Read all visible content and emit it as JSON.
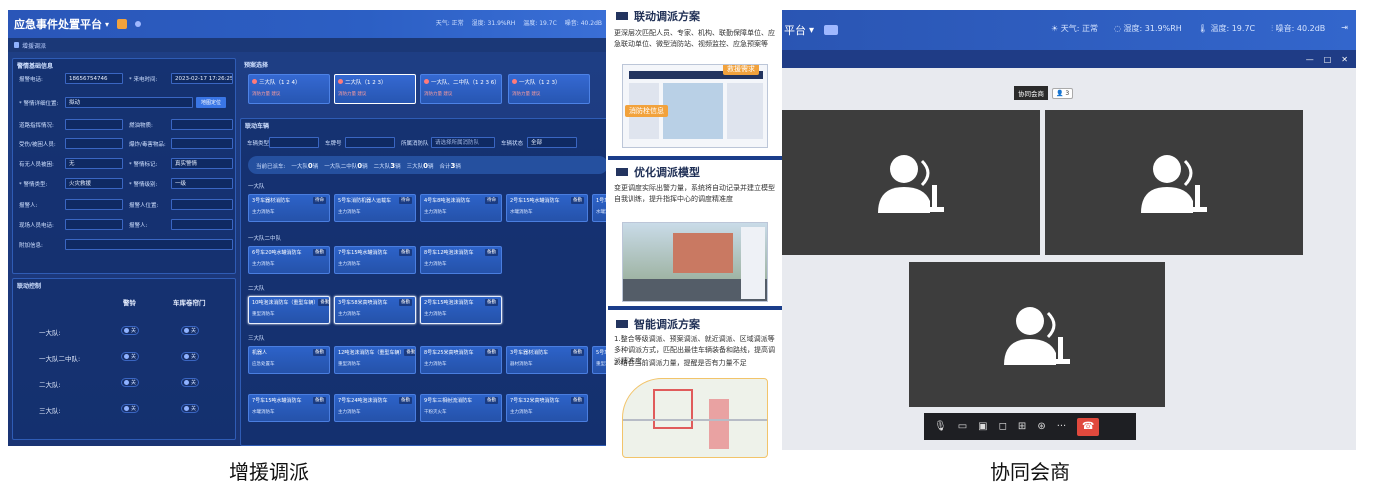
{
  "left": {
    "title": "应急事件处置平台",
    "status": [
      "天气: 正常",
      "湿度: 31.9%RH",
      "温度: 19.7C",
      "噪音: 40.2dB"
    ],
    "subbar": "增援调派",
    "info": {
      "title": "警情基础信息",
      "phone_label": "报警电话:",
      "phone_value": "18656754746",
      "time_label": "* 来电时间:",
      "time_value": "2023-02-17 17:26:25",
      "addr_label": "* 警情详细位置:",
      "addr_value": "拟动",
      "map_btn": "地图定位",
      "r3a": "道路指挥情况:",
      "r3b": "燃油物质:",
      "r4a": "受伤/被困人员:",
      "r4b": "爆炸/毒害物品:",
      "r5a": "有无人员被困:",
      "r5a_val": "无",
      "r5b": "* 警情标记:",
      "r5b_val": "真实警情",
      "r6a": "* 警情类型:",
      "r6a_val": "火灾救援",
      "r6b": "* 警情级别:",
      "r6b_val": "一级",
      "r7a": "报警人:",
      "r7b": "报警人位置:",
      "r8a": "现场人员电话:",
      "r8b": "报警人:",
      "r9a": "附加信息:"
    },
    "linkage": {
      "title": "联动控制",
      "col1": "警铃",
      "col2": "车库卷帘门",
      "rows": [
        "一大队:",
        "一大队二中队:",
        "二大队:",
        "三大队:"
      ],
      "toggle": "关"
    },
    "plans": {
      "title": "预案选择",
      "items": [
        {
          "name": "三大队（1 2 4）",
          "sub": "消防力量  建议"
        },
        {
          "name": "二大队（1 2 3）",
          "sub": "消防力量  建议"
        },
        {
          "name": "一大队、二中队（1 2 3 6）",
          "sub": "消防力量  建议"
        },
        {
          "name": "一大队（1 2 3）",
          "sub": "消防力量  建议"
        }
      ]
    },
    "vehicles": {
      "title": "联动车辆",
      "f1": "车辆类型",
      "f2": "车牌号",
      "f3": "所属消防队",
      "f3_val": "请选择所属消防队",
      "f4": "车辆状态",
      "f4_val": "全部",
      "stats_prefix": "当前已派车:",
      "stats": [
        {
          "label": "一大队",
          "n": "0",
          "u": "辆"
        },
        {
          "label": "一大队二中队",
          "n": "0",
          "u": "辆"
        },
        {
          "label": "二大队",
          "n": "3",
          "u": "辆"
        },
        {
          "label": "三大队",
          "n": "0",
          "u": "辆"
        },
        {
          "label": "合计",
          "n": "3",
          "u": "辆"
        }
      ],
      "teams": [
        {
          "name": "一大队",
          "cards": [
            {
              "t": "3号车器材消防车",
              "s": "待命",
              "b": "主力消防车"
            },
            {
              "t": "5号车消防机器人运载车",
              "s": "待命",
              "b": "主力消防车"
            },
            {
              "t": "4号车8吨泡沫消防车",
              "s": "待命",
              "b": "主力消防车"
            },
            {
              "t": "2号车15吨水罐消防车",
              "s": "备勤",
              "b": "水罐消防车"
            },
            {
              "t": "1号车5吨水",
              "s": "",
              "b": "水罐消防车"
            }
          ]
        },
        {
          "name": "一大队二中队",
          "cards": [
            {
              "t": "6号车20吨水罐消防车",
              "s": "备勤",
              "b": "主力消防车"
            },
            {
              "t": "7号车15吨水罐消防车",
              "s": "备勤",
              "b": "主力消防车"
            },
            {
              "t": "8号车12吨泡沫消防车",
              "s": "备勤",
              "b": "主力消防车"
            }
          ]
        },
        {
          "name": "二大队",
          "cards": [
            {
              "t": "10吨泡沫消防车（重型车辆）",
              "s": "备勤",
              "b": "重型消防车"
            },
            {
              "t": "3号车58米高喷消防车",
              "s": "备勤",
              "b": "主力消防车"
            },
            {
              "t": "2号车15吨泡沫消防车",
              "s": "备勤",
              "b": "主力消防车"
            }
          ]
        },
        {
          "name": "三大队",
          "cards": [
            {
              "t": "机器人",
              "s": "备勤",
              "b": "应急处置车"
            },
            {
              "t": "12吨泡沫消防车（重型车辆）",
              "s": "备勤",
              "b": "重型消防车"
            },
            {
              "t": "8号车25米高喷消防车",
              "s": "备勤",
              "b": "主力消防车"
            },
            {
              "t": "3号车器材消防车",
              "s": "备勤",
              "b": "器材消防车"
            },
            {
              "t": "5号车20吨",
              "s": "",
              "b": "重型消防车"
            }
          ]
        },
        {
          "name": "",
          "cards": [
            {
              "t": "7号车15吨水罐消防车",
              "s": "备勤",
              "b": "水罐消防车"
            },
            {
              "t": "7号车24吨泡沫消防车",
              "s": "备勤",
              "b": "主力消防车"
            },
            {
              "t": "9号车三相射流消防车",
              "s": "备勤",
              "b": "干粉灭火车"
            },
            {
              "t": "7号车32米高喷消防车",
              "s": "备勤",
              "b": "主力消防车"
            }
          ]
        }
      ]
    }
  },
  "middle": {
    "s1": {
      "title": "联动调派方案",
      "text": "更深层次匹配人员、专家、机构、联勤保障单位、应急联动单位、微型消防站、视频监控、应急预案等",
      "tag1": "救援需求",
      "tag2": "消防栓信息"
    },
    "s2": {
      "title": "优化调派模型",
      "text": "变更调度实际出警力量，系统将自动记录并建立模型自我训练，提升指挥中心的调度精准度"
    },
    "s3": {
      "title": "智能调派方案",
      "text1": "1.整合等级调派、预案调派、就近调派、区域调派等多种调派方式，匹配出最佳车辆装备和路线，提高调派精准度",
      "text2": "2.结合当前调派力量，提醒是否有力量不足"
    }
  },
  "right": {
    "title": "平台",
    "status": [
      "天气: 正常",
      "湿度: 31.9%RH",
      "温度: 19.7C",
      "噪音: 40.2dB"
    ],
    "window_controls": [
      "—",
      "□",
      "✕"
    ],
    "meeting_label": "协同会商",
    "meeting_count": "3"
  },
  "captions": {
    "left": "增援调派",
    "right": "协同会商"
  },
  "colors": {
    "app_bg": "#1a3474",
    "accent": "#3a76e6",
    "hangup": "#e0493d"
  }
}
